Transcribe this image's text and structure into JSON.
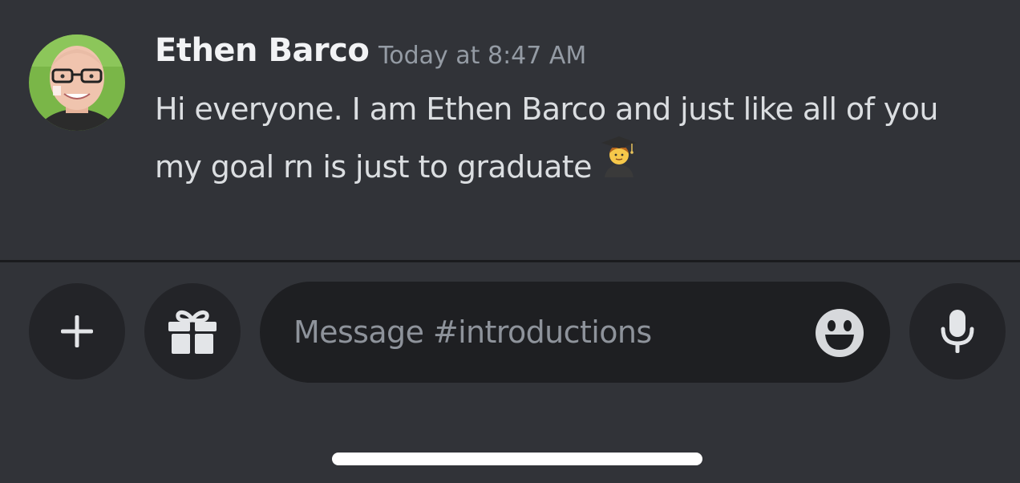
{
  "message": {
    "author": "Ethen Barco",
    "timestamp": "Today at 8:47 AM",
    "lines": [
      "Hi everyone. I am Ethen Barco and just like all of you",
      "my goal rn is just to graduate"
    ],
    "emoji": "student-emoji"
  },
  "composer": {
    "placeholder": "Message #introductions",
    "value": "",
    "buttons": [
      "plus-icon",
      "gift-icon",
      "smiley-icon",
      "microphone-icon"
    ]
  },
  "colors": {
    "background": "#313338",
    "button_bg": "#232428",
    "input_bg": "#1e1f22",
    "author": "#f2f3f5",
    "text": "#dbdee1",
    "muted": "#949ba4"
  }
}
